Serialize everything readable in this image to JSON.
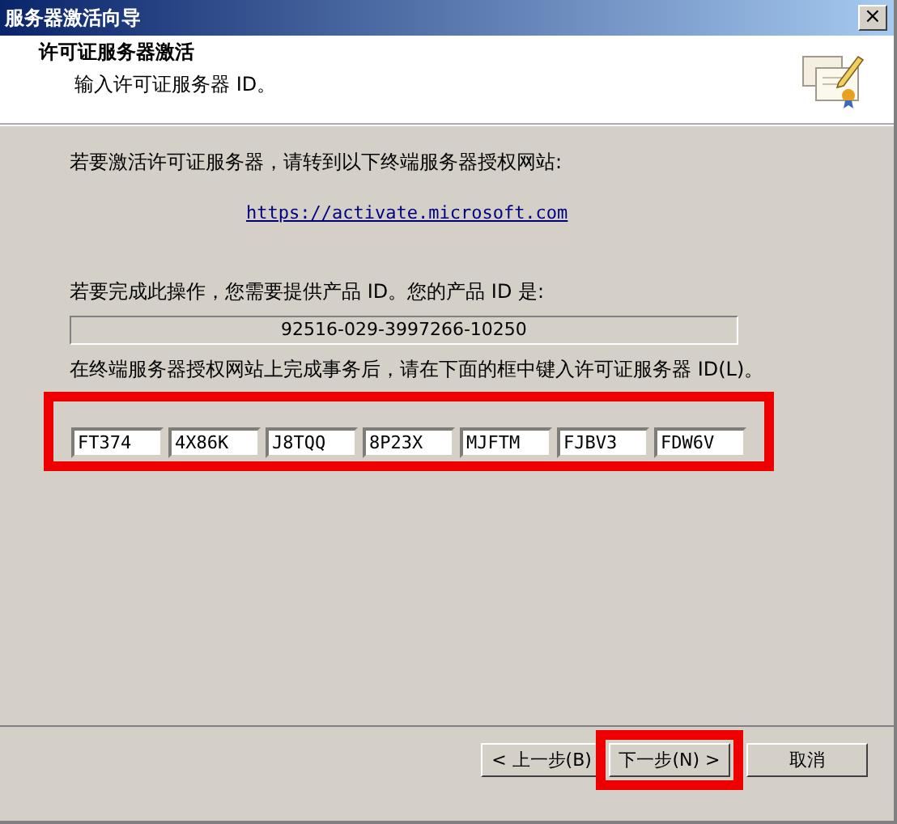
{
  "window": {
    "title": "服务器激活向导",
    "close": "×"
  },
  "header": {
    "title": "许可证服务器激活",
    "subtitle": "输入许可证服务器 ID。"
  },
  "instruction": "若要激活许可证服务器，请转到以下终端服务器授权网站:",
  "link": "https://activate.microsoft.com",
  "product_id_label": "若要完成此操作，您需要提供产品 ID。您的产品 ID 是:",
  "product_id": "92516-029-3997266-10250",
  "server_id_label": "在终端服务器授权网站上完成事务后，请在下面的框中键入许可证服务器 ID(L)。",
  "server_id_fields": [
    "FT374",
    "4X86K",
    "J8TQQ",
    "8P23X",
    "MJFTM",
    "FJBV3",
    "FDW6V"
  ],
  "buttons": [
    {
      "label": "< 上一步(B)",
      "highlighted": false
    },
    {
      "label": "下一步(N) >",
      "highlighted": true
    },
    {
      "label": "取消",
      "highlighted": false
    }
  ]
}
